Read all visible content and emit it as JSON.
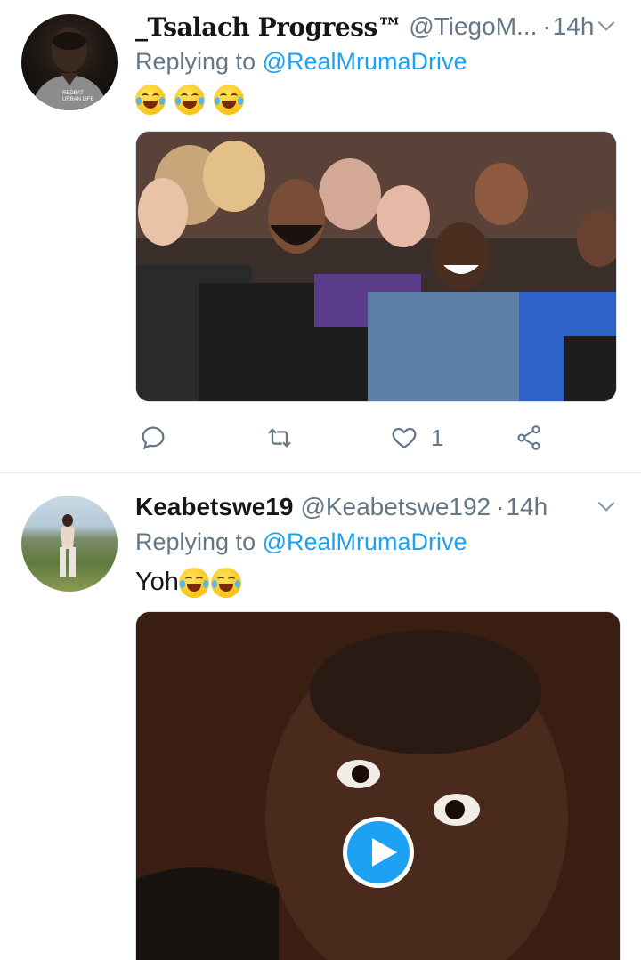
{
  "tweets": [
    {
      "display_name": "_Tsalach Progress™",
      "handle": "@TiegoM...",
      "dot": "·",
      "time": "14h",
      "replying_prefix": "Replying to",
      "replying_to": "@RealMrumaDrive",
      "text": "",
      "emojis": [
        "rolling-on-floor-laughing",
        "rolling-on-floor-laughing",
        "rolling-on-floor-laughing"
      ],
      "avatar_text": "REDBAT URBAN LIFE",
      "media_type": "photo",
      "actions": {
        "reply_icon": "comment-icon",
        "retweet_icon": "retweet-icon",
        "like_icon": "heart-icon",
        "like_count": "1",
        "share_icon": "share-icon"
      }
    },
    {
      "display_name": "Keabetswe19",
      "handle": "@Keabetswe192",
      "dot": "·",
      "time": "14h",
      "replying_prefix": "Replying to",
      "replying_to": "@RealMrumaDrive",
      "text": "Yoh",
      "emojis": [
        "face-with-tears-of-joy",
        "face-with-tears-of-joy"
      ],
      "media_type": "video"
    }
  ],
  "colors": {
    "accent": "#1da1f2",
    "secondary_text": "#657786",
    "primary_text": "#14171a",
    "divider": "#e1e8ed"
  }
}
